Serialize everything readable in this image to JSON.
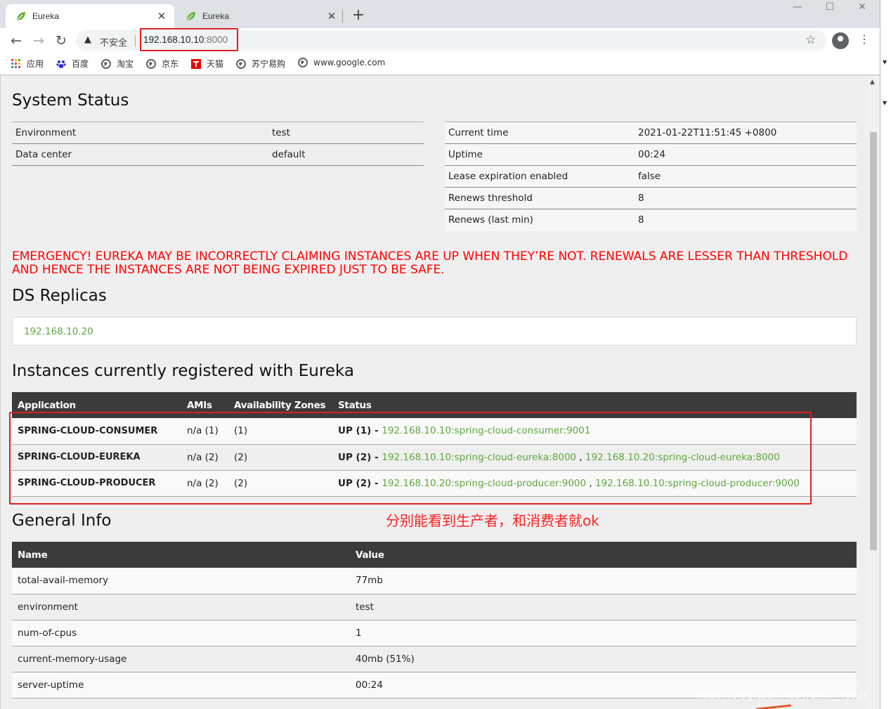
{
  "browser": {
    "tabs": [
      {
        "title": "Eureka",
        "close": "✕"
      },
      {
        "title": "Eureka",
        "close": "✕"
      }
    ],
    "new_tab": "+",
    "window_controls": {
      "minimize": "—",
      "maximize": "☐",
      "close": "✕"
    },
    "nav": {
      "back": "←",
      "forward": "→",
      "reload": "↻"
    },
    "omnibox": {
      "security_icon": "warning-triangle",
      "security_label": "不安全",
      "url_host": "192.168.10.10",
      "url_port": ":8000"
    },
    "star": "☆",
    "menu": "⋮",
    "bookmarks": [
      {
        "label": "应用",
        "icon": "apps-grid-icon"
      },
      {
        "label": "百度",
        "icon": "baidu-paw-icon"
      },
      {
        "label": "淘宝",
        "icon": "globe-icon"
      },
      {
        "label": "京东",
        "icon": "globe-icon"
      },
      {
        "label": "天猫",
        "icon": "tmall-icon"
      },
      {
        "label": "苏宁易购",
        "icon": "globe-icon"
      },
      {
        "label": "www.google.com",
        "icon": "globe-icon"
      }
    ]
  },
  "page": {
    "system_status_title": "System Status",
    "env_table": [
      {
        "key": "Environment",
        "value": "test"
      },
      {
        "key": "Data center",
        "value": "default"
      }
    ],
    "status_table": [
      {
        "key": "Current time",
        "value": "2021-01-22T11:51:45 +0800"
      },
      {
        "key": "Uptime",
        "value": "00:24"
      },
      {
        "key": "Lease expiration enabled",
        "value": "false"
      },
      {
        "key": "Renews threshold",
        "value": "8"
      },
      {
        "key": "Renews (last min)",
        "value": "8"
      }
    ],
    "emergency": "EMERGENCY! EUREKA MAY BE INCORRECTLY CLAIMING INSTANCES ARE UP WHEN THEY’RE NOT. RENEWALS ARE LESSER THAN THRESHOLD AND HENCE THE INSTANCES ARE NOT BEING EXPIRED JUST TO BE SAFE.",
    "ds_replicas_title": "DS Replicas",
    "ds_replica": "192.168.10.20",
    "instances_title": "Instances currently registered with Eureka",
    "instances_headers": [
      "Application",
      "AMIs",
      "Availability Zones",
      "Status"
    ],
    "instances": [
      {
        "app": "SPRING-CLOUD-CONSUMER",
        "amis": "n/a (1)",
        "zones": "(1)",
        "status": "UP (1) - ",
        "links": [
          "192.168.10.10:spring-cloud-consumer:9001"
        ]
      },
      {
        "app": "SPRING-CLOUD-EUREKA",
        "amis": "n/a (2)",
        "zones": "(2)",
        "status": "UP (2) - ",
        "links": [
          "192.168.10.10:spring-cloud-eureka:8000",
          "192.168.10.20:spring-cloud-eureka:8000"
        ]
      },
      {
        "app": "SPRING-CLOUD-PRODUCER",
        "amis": "n/a (2)",
        "zones": "(2)",
        "status": "UP (2) - ",
        "links": [
          "192.168.10.20:spring-cloud-producer:9000",
          "192.168.10.10:spring-cloud-producer:9000"
        ]
      }
    ],
    "annotation": "分别能看到生产者，和消费者就ok",
    "general_info_title": "General Info",
    "general_headers": [
      "Name",
      "Value"
    ],
    "general_info": [
      {
        "name": "total-avail-memory",
        "value": "77mb"
      },
      {
        "name": "environment",
        "value": "test"
      },
      {
        "name": "num-of-cpus",
        "value": "1"
      },
      {
        "name": "current-memory-usage",
        "value": "40mb (51%)"
      },
      {
        "name": "server-uptime",
        "value": "00:24"
      }
    ],
    "watermark": "https://blog.csdn.net/weixin_46936641"
  },
  "colors": {
    "link_green": "#5ea73d",
    "emergency_red": "#ff0000",
    "table_header": "#3b3b3b",
    "highlight_red": "#e02020"
  }
}
